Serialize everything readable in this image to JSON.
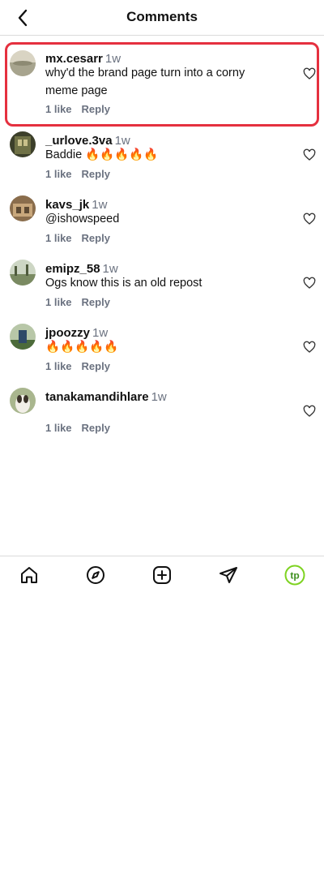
{
  "header": {
    "title": "Comments",
    "back_icon": "chevron-left-icon"
  },
  "comments": [
    {
      "username": "mx.cesarr",
      "time": "1w",
      "text": "why'd the brand page turn into a corny meme page",
      "likes": "1 like",
      "reply": "Reply",
      "highlighted": true
    },
    {
      "username": "_urlove.3va",
      "time": "1w",
      "text": "Baddie 🔥🔥🔥🔥🔥",
      "likes": "1 like",
      "reply": "Reply"
    },
    {
      "username": "kavs_jk",
      "time": "1w",
      "text": "@ishowspeed",
      "likes": "1 like",
      "reply": "Reply"
    },
    {
      "username": "emipz_58",
      "time": "1w",
      "text": "Ogs know this is an old repost",
      "likes": "1 like",
      "reply": "Reply"
    },
    {
      "username": "jpoozzy",
      "time": "1w",
      "text": "🔥🔥🔥🔥🔥",
      "likes": "1 like",
      "reply": "Reply"
    },
    {
      "username": "tanakamandihlare",
      "time": "1w",
      "text": "",
      "likes": "1 like",
      "reply": "Reply"
    }
  ],
  "nav": {
    "items": [
      "home-icon",
      "explore-compass-icon",
      "create-plus-icon",
      "send-icon",
      "profile-avatar"
    ],
    "profile_initials": "tp"
  },
  "colors": {
    "highlight": "#e5303f",
    "secondary_text": "#6b7280",
    "profile_ring": "#7ed321"
  }
}
